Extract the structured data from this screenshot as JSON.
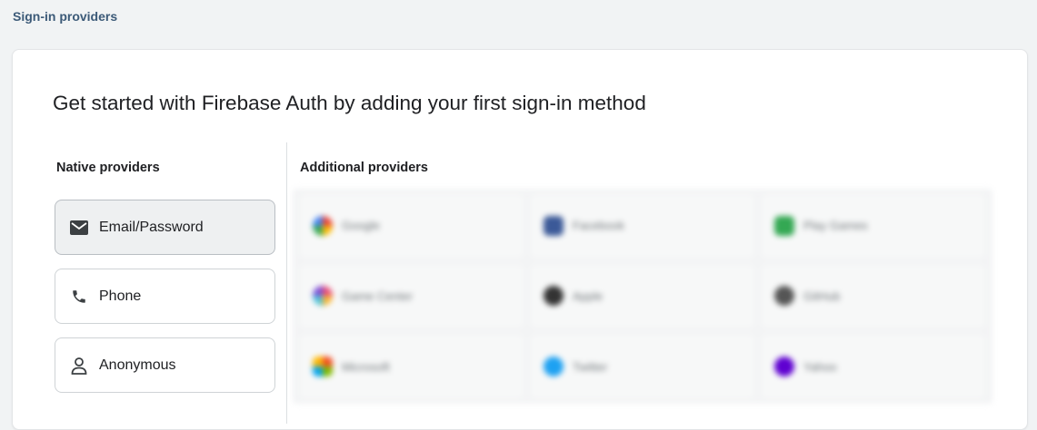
{
  "header": {
    "title": "Sign-in providers"
  },
  "card": {
    "heading": "Get started with Firebase Auth by adding your first sign-in method",
    "native": {
      "title": "Native providers",
      "providers": [
        {
          "label": "Email/Password",
          "icon": "mail-icon",
          "selected": true
        },
        {
          "label": "Phone",
          "icon": "phone-icon",
          "selected": false
        },
        {
          "label": "Anonymous",
          "icon": "person-icon",
          "selected": false
        }
      ]
    },
    "additional": {
      "title": "Additional providers",
      "providers": [
        {
          "label": "Google",
          "color": "#ea4335"
        },
        {
          "label": "Facebook",
          "color": "#3b5998"
        },
        {
          "label": "Play Games",
          "color": "#34a853"
        },
        {
          "label": "Game Center",
          "color": "#5b6ee1"
        },
        {
          "label": "Apple",
          "color": "#333333"
        },
        {
          "label": "GitHub",
          "color": "#555555"
        },
        {
          "label": "Microsoft",
          "color": "#f25022"
        },
        {
          "label": "Twitter",
          "color": "#1da1f2"
        },
        {
          "label": "Yahoo",
          "color": "#5f01d1"
        }
      ]
    }
  },
  "colors": {
    "accent": "#3c5a78",
    "background": "#f1f3f4"
  }
}
